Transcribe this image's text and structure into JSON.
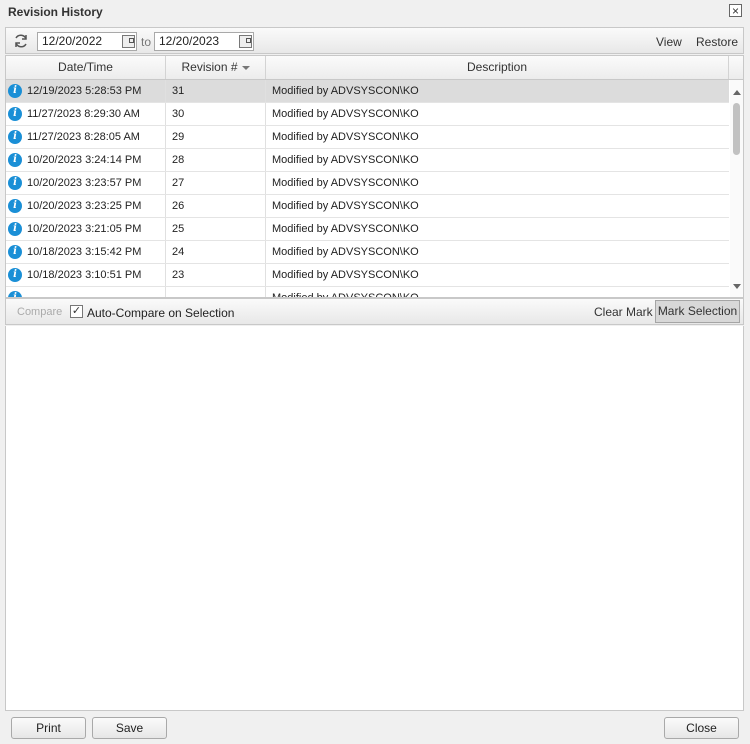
{
  "window": {
    "title": "Revision History"
  },
  "toolbar": {
    "date_from": "12/20/2022",
    "to_label": "to",
    "date_to": "12/20/2023",
    "view_label": "View",
    "restore_label": "Restore"
  },
  "grid": {
    "columns": [
      "Date/Time",
      "Revision #",
      "Description"
    ],
    "rows": [
      {
        "datetime": "12/19/2023 5:28:53 PM",
        "revision": "31",
        "description": "Modified by ADVSYSCON\\KO",
        "selected": true
      },
      {
        "datetime": "11/27/2023 8:29:30 AM",
        "revision": "30",
        "description": "Modified by ADVSYSCON\\KO"
      },
      {
        "datetime": "11/27/2023 8:28:05 AM",
        "revision": "29",
        "description": "Modified by ADVSYSCON\\KO"
      },
      {
        "datetime": "10/20/2023 3:24:14 PM",
        "revision": "28",
        "description": "Modified by ADVSYSCON\\KO"
      },
      {
        "datetime": "10/20/2023 3:23:57 PM",
        "revision": "27",
        "description": "Modified by ADVSYSCON\\KO"
      },
      {
        "datetime": "10/20/2023 3:23:25 PM",
        "revision": "26",
        "description": "Modified by ADVSYSCON\\KO"
      },
      {
        "datetime": "10/20/2023 3:21:05 PM",
        "revision": "25",
        "description": "Modified by ADVSYSCON\\KO"
      },
      {
        "datetime": "10/18/2023 3:15:42 PM",
        "revision": "24",
        "description": "Modified by ADVSYSCON\\KO"
      },
      {
        "datetime": "10/18/2023 3:10:51 PM",
        "revision": "23",
        "description": "Modified by ADVSYSCON\\KO"
      },
      {
        "datetime": "",
        "revision": "",
        "description": "Modified by ADVSYSCON\\KO"
      }
    ]
  },
  "compare_bar": {
    "compare_label": "Compare",
    "auto_compare_label": "Auto-Compare on Selection",
    "auto_compare_checked": "✓",
    "clear_mark_label": "Clear Mark",
    "mark_selection_label": "Mark Selection"
  },
  "footer": {
    "print_label": "Print",
    "save_label": "Save",
    "close_label": "Close"
  },
  "colors": {
    "info_icon": "#1a8fd6",
    "selected_row": "#dcdcdc"
  }
}
